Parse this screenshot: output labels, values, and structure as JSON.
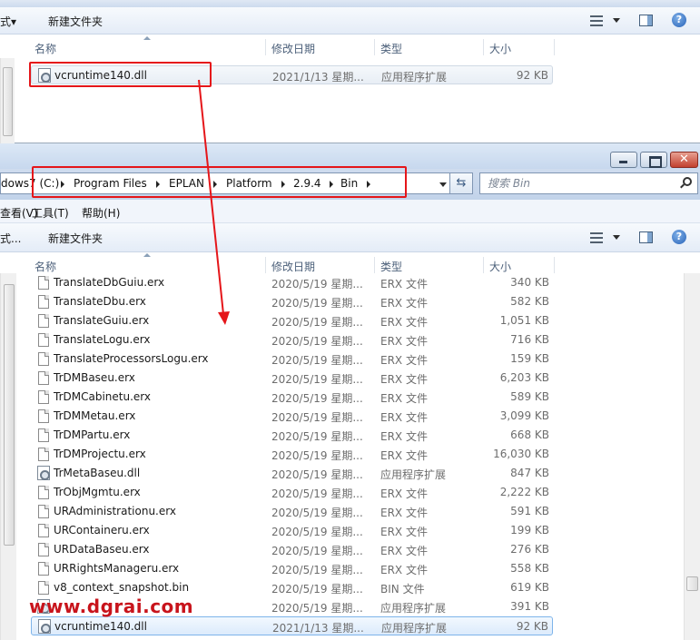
{
  "top_window": {
    "toolbar": {
      "left_text": "式▾",
      "new_folder": "新建文件夹"
    },
    "columns": {
      "name": "名称",
      "date": "修改日期",
      "type": "类型",
      "size": "大小"
    },
    "file": {
      "name": "vcruntime140.dll",
      "date": "2021/1/13 星期...",
      "type": "应用程序扩展",
      "size": "92 KB"
    }
  },
  "bottom_window": {
    "address": {
      "crumbs": [
        "dows7 (C:)",
        "Program Files",
        "EPLAN",
        "Platform",
        "2.9.4",
        "Bin"
      ]
    },
    "search": {
      "placeholder": "搜索 Bin"
    },
    "menu": {
      "view": "查看(V)",
      "tools": "工具(T)",
      "help": "帮助(H)"
    },
    "toolbar": {
      "left_text": "式...",
      "new_folder": "新建文件夹"
    },
    "columns": {
      "name": "名称",
      "date": "修改日期",
      "type": "类型",
      "size": "大小"
    },
    "files": [
      {
        "name": "TranslateDbGuiu.erx",
        "date": "2020/5/19 星期...",
        "type": "ERX 文件",
        "size": "340 KB",
        "icon": "file-icon"
      },
      {
        "name": "TranslateDbu.erx",
        "date": "2020/5/19 星期...",
        "type": "ERX 文件",
        "size": "582 KB",
        "icon": "file-icon"
      },
      {
        "name": "TranslateGuiu.erx",
        "date": "2020/5/19 星期...",
        "type": "ERX 文件",
        "size": "1,051 KB",
        "icon": "file-icon"
      },
      {
        "name": "TranslateLogu.erx",
        "date": "2020/5/19 星期...",
        "type": "ERX 文件",
        "size": "716 KB",
        "icon": "file-icon"
      },
      {
        "name": "TranslateProcessorsLogu.erx",
        "date": "2020/5/19 星期...",
        "type": "ERX 文件",
        "size": "159 KB",
        "icon": "file-icon"
      },
      {
        "name": "TrDMBaseu.erx",
        "date": "2020/5/19 星期...",
        "type": "ERX 文件",
        "size": "6,203 KB",
        "icon": "file-icon"
      },
      {
        "name": "TrDMCabinetu.erx",
        "date": "2020/5/19 星期...",
        "type": "ERX 文件",
        "size": "589 KB",
        "icon": "file-icon"
      },
      {
        "name": "TrDMMetau.erx",
        "date": "2020/5/19 星期...",
        "type": "ERX 文件",
        "size": "3,099 KB",
        "icon": "file-icon"
      },
      {
        "name": "TrDMPartu.erx",
        "date": "2020/5/19 星期...",
        "type": "ERX 文件",
        "size": "668 KB",
        "icon": "file-icon"
      },
      {
        "name": "TrDMProjectu.erx",
        "date": "2020/5/19 星期...",
        "type": "ERX 文件",
        "size": "16,030 KB",
        "icon": "file-icon"
      },
      {
        "name": "TrMetaBaseu.dll",
        "date": "2020/5/19 星期...",
        "type": "应用程序扩展",
        "size": "847 KB",
        "icon": "dll-icon"
      },
      {
        "name": "TrObjMgmtu.erx",
        "date": "2020/5/19 星期...",
        "type": "ERX 文件",
        "size": "2,222 KB",
        "icon": "file-icon"
      },
      {
        "name": "URAdministrationu.erx",
        "date": "2020/5/19 星期...",
        "type": "ERX 文件",
        "size": "591 KB",
        "icon": "file-icon"
      },
      {
        "name": "URContaineru.erx",
        "date": "2020/5/19 星期...",
        "type": "ERX 文件",
        "size": "199 KB",
        "icon": "file-icon"
      },
      {
        "name": "URDataBaseu.erx",
        "date": "2020/5/19 星期...",
        "type": "ERX 文件",
        "size": "276 KB",
        "icon": "file-icon"
      },
      {
        "name": "URRightsManageru.erx",
        "date": "2020/5/19 星期...",
        "type": "ERX 文件",
        "size": "558 KB",
        "icon": "file-icon"
      },
      {
        "name": "v8_context_snapshot.bin",
        "date": "2020/5/19 星期...",
        "type": "BIN 文件",
        "size": "619 KB",
        "icon": "file-icon"
      },
      {
        "name": "",
        "date": "2020/5/19 星期...",
        "type": "应用程序扩展",
        "size": "391 KB",
        "icon": "dll-icon"
      },
      {
        "name": "vcruntime140.dll",
        "date": "2021/1/13 星期...",
        "type": "应用程序扩展",
        "size": "92 KB",
        "icon": "dll-icon"
      }
    ]
  },
  "watermark": "www.dgrai.com",
  "colors": {
    "annotation_red": "#e5161a",
    "selection_blue": "#7eb4ea"
  }
}
